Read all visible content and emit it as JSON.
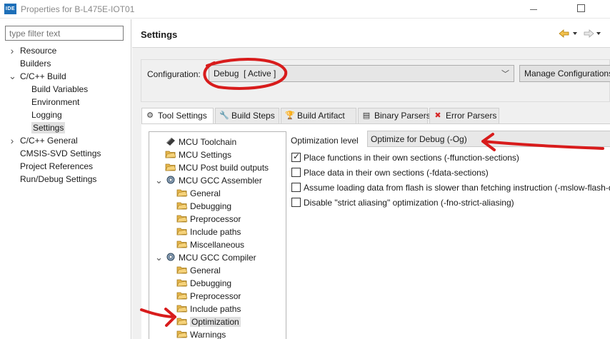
{
  "window": {
    "app_icon_text": "IDE",
    "title": "Properties for B-L475E-IOT01"
  },
  "left": {
    "filter_placeholder": "type filter text",
    "nav": [
      {
        "label": "Resource",
        "level": 0,
        "expander": "collapsed"
      },
      {
        "label": "Builders",
        "level": 0,
        "expander": "none"
      },
      {
        "label": "C/C++ Build",
        "level": 0,
        "expander": "expanded"
      },
      {
        "label": "Build Variables",
        "level": 1,
        "expander": "none"
      },
      {
        "label": "Environment",
        "level": 1,
        "expander": "none"
      },
      {
        "label": "Logging",
        "level": 1,
        "expander": "none"
      },
      {
        "label": "Settings",
        "level": 1,
        "expander": "none",
        "selected": true
      },
      {
        "label": "C/C++ General",
        "level": 0,
        "expander": "collapsed"
      },
      {
        "label": "CMSIS-SVD Settings",
        "level": 0,
        "expander": "none"
      },
      {
        "label": "Project References",
        "level": 0,
        "expander": "none"
      },
      {
        "label": "Run/Debug Settings",
        "level": 0,
        "expander": "none"
      }
    ]
  },
  "settings": {
    "title": "Settings",
    "configuration_label": "Configuration:",
    "configuration_value": "Debug  [ Active ]",
    "manage_button": "Manage Configurations...",
    "tabs": [
      {
        "label": "Tool Settings",
        "icon": "gear-icon",
        "active": true
      },
      {
        "label": "Build Steps",
        "icon": "wrench-icon"
      },
      {
        "label": "Build Artifact",
        "icon": "trophy-icon"
      },
      {
        "label": "Binary Parsers",
        "icon": "binary-file-icon"
      },
      {
        "label": "Error Parsers",
        "icon": "error-icon"
      }
    ],
    "tree": [
      {
        "label": "MCU Toolchain",
        "icon": "toolchain-icon",
        "level": 0
      },
      {
        "label": "MCU Settings",
        "icon": "folder-icon",
        "level": 0
      },
      {
        "label": "MCU Post build outputs",
        "icon": "folder-icon",
        "level": 0
      },
      {
        "label": "MCU GCC Assembler",
        "icon": "gear-icon",
        "level": 0,
        "expander": "expanded"
      },
      {
        "label": "General",
        "icon": "folder-icon",
        "level": 1
      },
      {
        "label": "Debugging",
        "icon": "folder-icon",
        "level": 1
      },
      {
        "label": "Preprocessor",
        "icon": "folder-icon",
        "level": 1
      },
      {
        "label": "Include paths",
        "icon": "folder-icon",
        "level": 1
      },
      {
        "label": "Miscellaneous",
        "icon": "folder-icon",
        "level": 1
      },
      {
        "label": "MCU GCC Compiler",
        "icon": "gear-icon",
        "level": 0,
        "expander": "expanded"
      },
      {
        "label": "General",
        "icon": "folder-icon",
        "level": 1
      },
      {
        "label": "Debugging",
        "icon": "folder-icon",
        "level": 1
      },
      {
        "label": "Preprocessor",
        "icon": "folder-icon",
        "level": 1
      },
      {
        "label": "Include paths",
        "icon": "folder-icon",
        "level": 1
      },
      {
        "label": "Optimization",
        "icon": "folder-icon",
        "level": 1,
        "selected": true
      },
      {
        "label": "Warnings",
        "icon": "folder-icon",
        "level": 1
      }
    ],
    "optimization_label": "Optimization level",
    "optimization_value": "Optimize for Debug (-Og)",
    "options": [
      {
        "label": "Place functions in their own sections (-ffunction-sections)",
        "checked": true
      },
      {
        "label": "Place data in their own sections (-fdata-sections)",
        "checked": false
      },
      {
        "label": "Assume loading data from flash is slower than fetching instruction (-mslow-flash-data)",
        "checked": false
      },
      {
        "label": "Disable \"strict aliasing\" optimization (-fno-strict-aliasing)",
        "checked": false
      }
    ]
  },
  "colors": {
    "annotation": "#d81c1c",
    "folder": "#e5b54a",
    "selection": "#e0e0e0"
  }
}
